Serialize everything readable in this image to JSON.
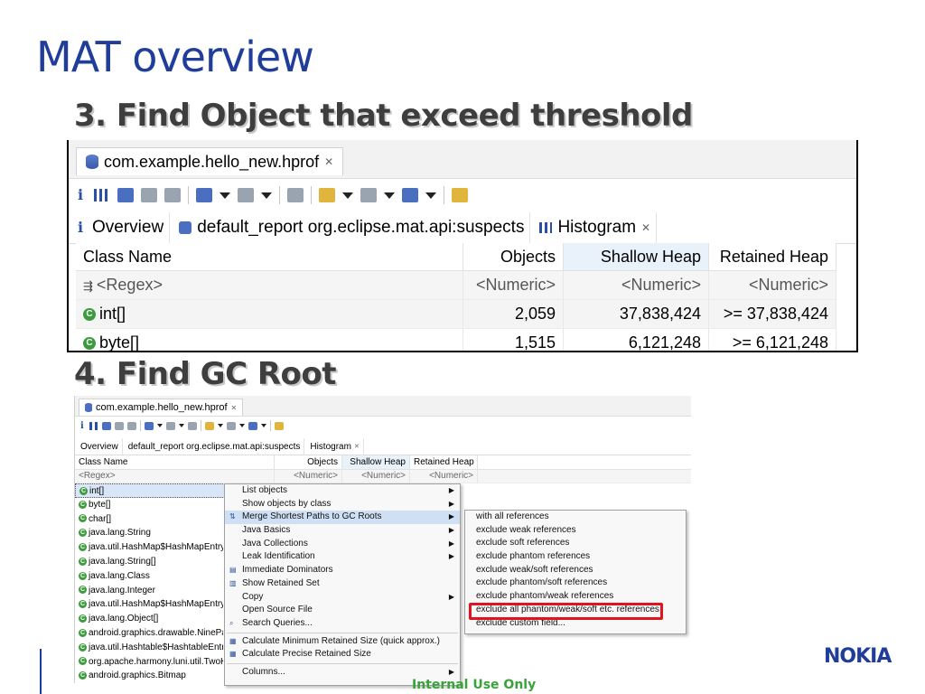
{
  "slide_title": "MAT overview",
  "step3_heading": "3. Find Object that exceed threshold",
  "step4_heading": "4. Find GC Root",
  "shot1": {
    "editor_tab": "com.example.hello_new.hprof",
    "subtabs": [
      "Overview",
      "default_report  org.eclipse.mat.api:suspects",
      "Histogram"
    ],
    "columns": [
      "Class Name",
      "Objects",
      "Shallow Heap",
      "Retained Heap"
    ],
    "filter_row": [
      "<Regex>",
      "<Numeric>",
      "<Numeric>",
      "<Numeric>"
    ],
    "rows": [
      {
        "name": "int[]",
        "objects": "2,059",
        "shallow": "37,838,424",
        "retained": ">= 37,838,424"
      },
      {
        "name": "byte[]",
        "objects": "1,515",
        "shallow": "6,121,248",
        "retained": ">= 6,121,248"
      }
    ]
  },
  "shot2": {
    "editor_tab": "com.example.hello_new.hprof",
    "subtabs": [
      "Overview",
      "default_report  org.eclipse.mat.api:suspects",
      "Histogram"
    ],
    "columns": [
      "Class Name",
      "Objects",
      "Shallow Heap",
      "Retained Heap"
    ],
    "filter_row": [
      "<Regex>",
      "<Numeric>",
      "<Numeric>",
      "<Numeric>"
    ],
    "rows": [
      "int[]",
      "byte[]",
      "char[]",
      "java.lang.String",
      "java.util.HashMap$HashMapEntry",
      "java.lang.String[]",
      "java.lang.Class",
      "java.lang.Integer",
      "java.util.HashMap$HashMapEntry[]",
      "java.lang.Object[]",
      "android.graphics.drawable.NinePatc",
      "java.util.Hashtable$HashtableEntry",
      "org.apache.harmony.luni.util.TwoKe",
      "android.graphics.Bitmap"
    ],
    "context_menu": [
      "List objects",
      "Show objects by class",
      "Merge Shortest Paths to GC Roots",
      "Java Basics",
      "Java Collections",
      "Leak Identification",
      "Immediate Dominators",
      "Show Retained Set",
      "Copy",
      "Open Source File",
      "Search Queries...",
      "Calculate Minimum Retained Size (quick approx.)",
      "Calculate Precise Retained Size",
      "Columns..."
    ],
    "submenu": [
      "with all references",
      "exclude weak references",
      "exclude soft references",
      "exclude phantom references",
      "exclude weak/soft references",
      "exclude phantom/soft references",
      "exclude phantom/weak references",
      "exclude all phantom/weak/soft etc. references",
      "exclude custom field..."
    ]
  },
  "footer_text": "Internal Use Only",
  "logo_text": "NOKIA",
  "colors": {
    "title_blue": "#1f3d99",
    "highlight_red": "#e0141e",
    "footer_green": "#3aa23a"
  }
}
